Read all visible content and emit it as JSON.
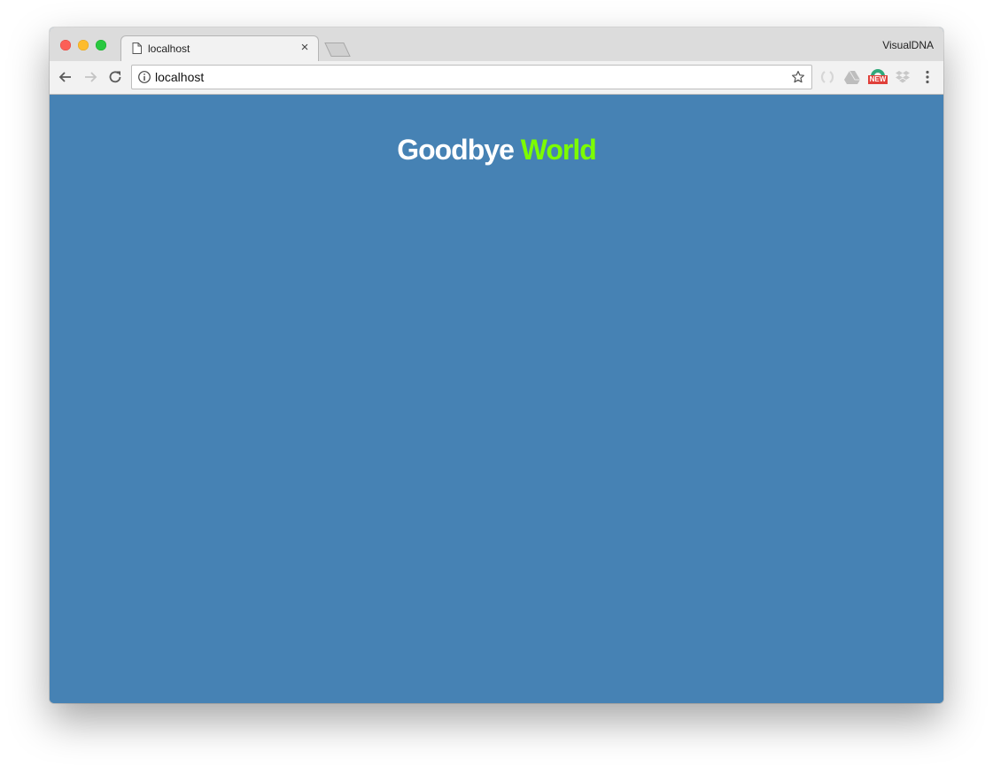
{
  "window": {
    "profile_name": "VisualDNA"
  },
  "tab": {
    "title": "localhost",
    "close_glyph": "×"
  },
  "omnibox": {
    "url": "localhost"
  },
  "extensions": {
    "new_badge": "NEW"
  },
  "page": {
    "heading_word_1": "Goodbye",
    "heading_word_2": "World"
  },
  "colors": {
    "page_background": "#4682b4",
    "heading_primary": "#ffffff",
    "heading_accent": "#7cfc00"
  },
  "icons": [
    "page-icon",
    "back-arrow-icon",
    "forward-arrow-icon",
    "reload-icon",
    "info-icon",
    "star-icon",
    "extension-icon",
    "drive-icon",
    "new-extension-icon",
    "dropbox-icon",
    "menu-dots-icon"
  ]
}
